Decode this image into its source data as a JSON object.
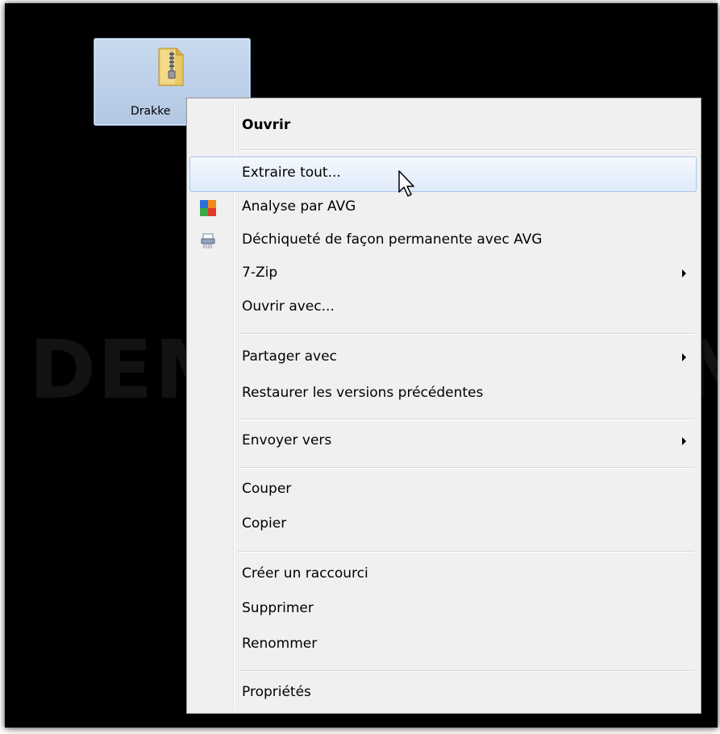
{
  "desktop": {
    "selected_item": {
      "name": "Drakke",
      "icon": "zip-folder-icon"
    },
    "watermark": "DEMO VERSION"
  },
  "context_menu": {
    "items": [
      {
        "label": "Ouvrir",
        "bold": true
      },
      {
        "label": "Extraire tout...",
        "highlighted": true
      },
      {
        "label": "Analyse par AVG",
        "icon": "avg-icon"
      },
      {
        "label": "Déchiqueté de façon permanente avec AVG",
        "icon": "shredder-icon"
      },
      {
        "label": "7-Zip",
        "submenu": true
      },
      {
        "label": "Ouvrir avec..."
      },
      {
        "label": "Partager avec",
        "submenu": true
      },
      {
        "label": "Restaurer les versions précédentes"
      },
      {
        "label": "Envoyer vers",
        "submenu": true
      },
      {
        "label": "Couper"
      },
      {
        "label": "Copier"
      },
      {
        "label": "Créer un raccourci"
      },
      {
        "label": "Supprimer"
      },
      {
        "label": "Renommer"
      },
      {
        "label": "Propriétés"
      }
    ]
  },
  "colors": {
    "desktop_bg": "#000000",
    "menu_bg": "#f0f0f0",
    "highlight_border": "#a8c6ec",
    "selection_bg": "#c9d9ee"
  }
}
